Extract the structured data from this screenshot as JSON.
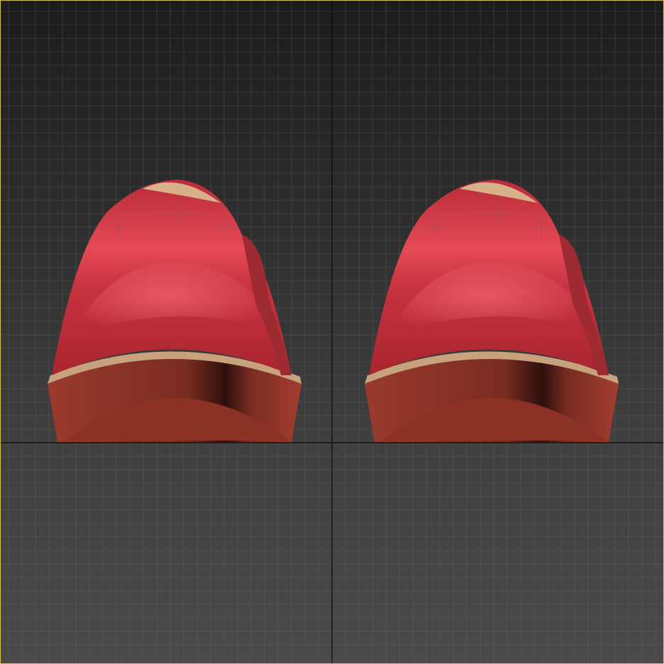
{
  "viewport": {
    "view": "perspective",
    "shading": "smooth",
    "grid": true,
    "active": true,
    "border_color": "#d6c64e",
    "bg_top": "#1c1c1c",
    "bg_bottom": "#4a4a4a",
    "grid_color": "#6a6a6a",
    "axis_color": "#0a0a0a"
  },
  "scene": {
    "objects": [
      {
        "name": "left-shoe",
        "color": "#c8323e"
      },
      {
        "name": "right-shoe",
        "color": "#c8323e"
      }
    ],
    "material": {
      "upper": "#c8323e",
      "highlight": "#ec5560",
      "trim": "#c8a27c",
      "sole": "#8a3226"
    }
  }
}
